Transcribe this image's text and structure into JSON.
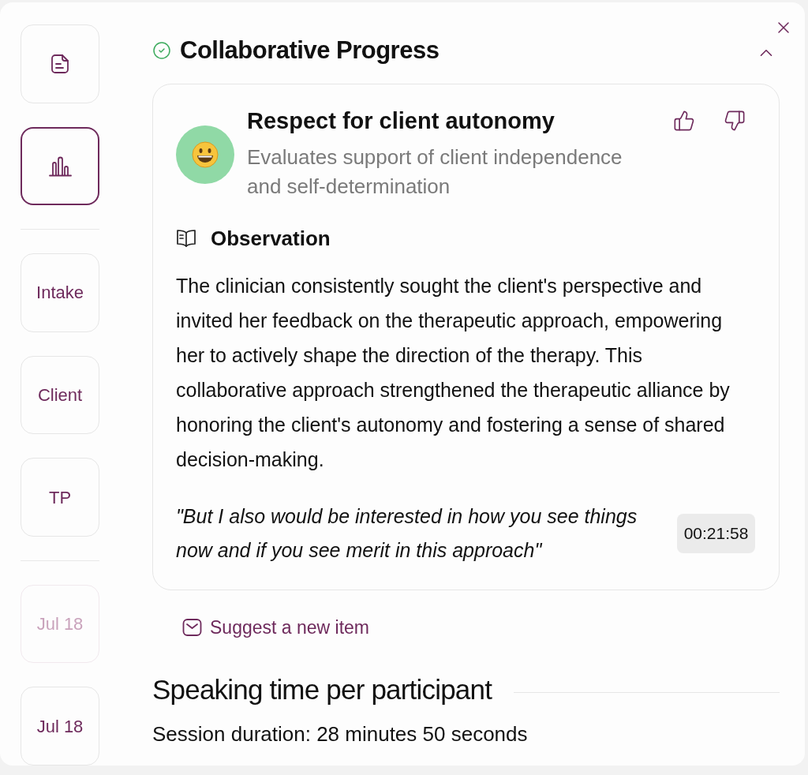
{
  "sidebar": {
    "sections": [
      {
        "items": [
          {
            "kind": "notes",
            "selected": false,
            "disabled": false
          },
          {
            "kind": "insights",
            "selected": true,
            "disabled": false
          }
        ]
      },
      {
        "items": [
          {
            "kind": "text",
            "label": "Intake",
            "selected": false,
            "disabled": false
          },
          {
            "kind": "text",
            "label": "Client",
            "selected": false,
            "disabled": false
          },
          {
            "kind": "text",
            "label": "TP",
            "selected": false,
            "disabled": false
          }
        ]
      },
      {
        "items": [
          {
            "kind": "text",
            "label": "Jul 18",
            "selected": false,
            "disabled": true
          },
          {
            "kind": "text",
            "label": "Jul 18",
            "selected": false,
            "disabled": false
          }
        ]
      }
    ]
  },
  "section": {
    "title": "Collaborative Progress",
    "expanded": true,
    "card": {
      "title": "Respect for client autonomy",
      "description": "Evaluates support of client independence and self-determination",
      "observation": {
        "heading": "Observation",
        "text": "The clinician consistently sought the client's perspective and invited her feedback on the therapeutic approach, empowering her to actively shape the direction of the therapy. This collaborative approach strengthened the therapeutic alliance by honoring the client's autonomy and fostering a sense of shared decision-making.",
        "quote": "\"But I also would be interested in how you see things now and if you see merit in this approach\"",
        "timestamp": "00:21:58"
      }
    },
    "suggest_link": "Suggest a new item"
  },
  "speaking_time": {
    "title": "Speaking time per participant",
    "duration": "Session duration: 28 minutes 50 seconds"
  }
}
